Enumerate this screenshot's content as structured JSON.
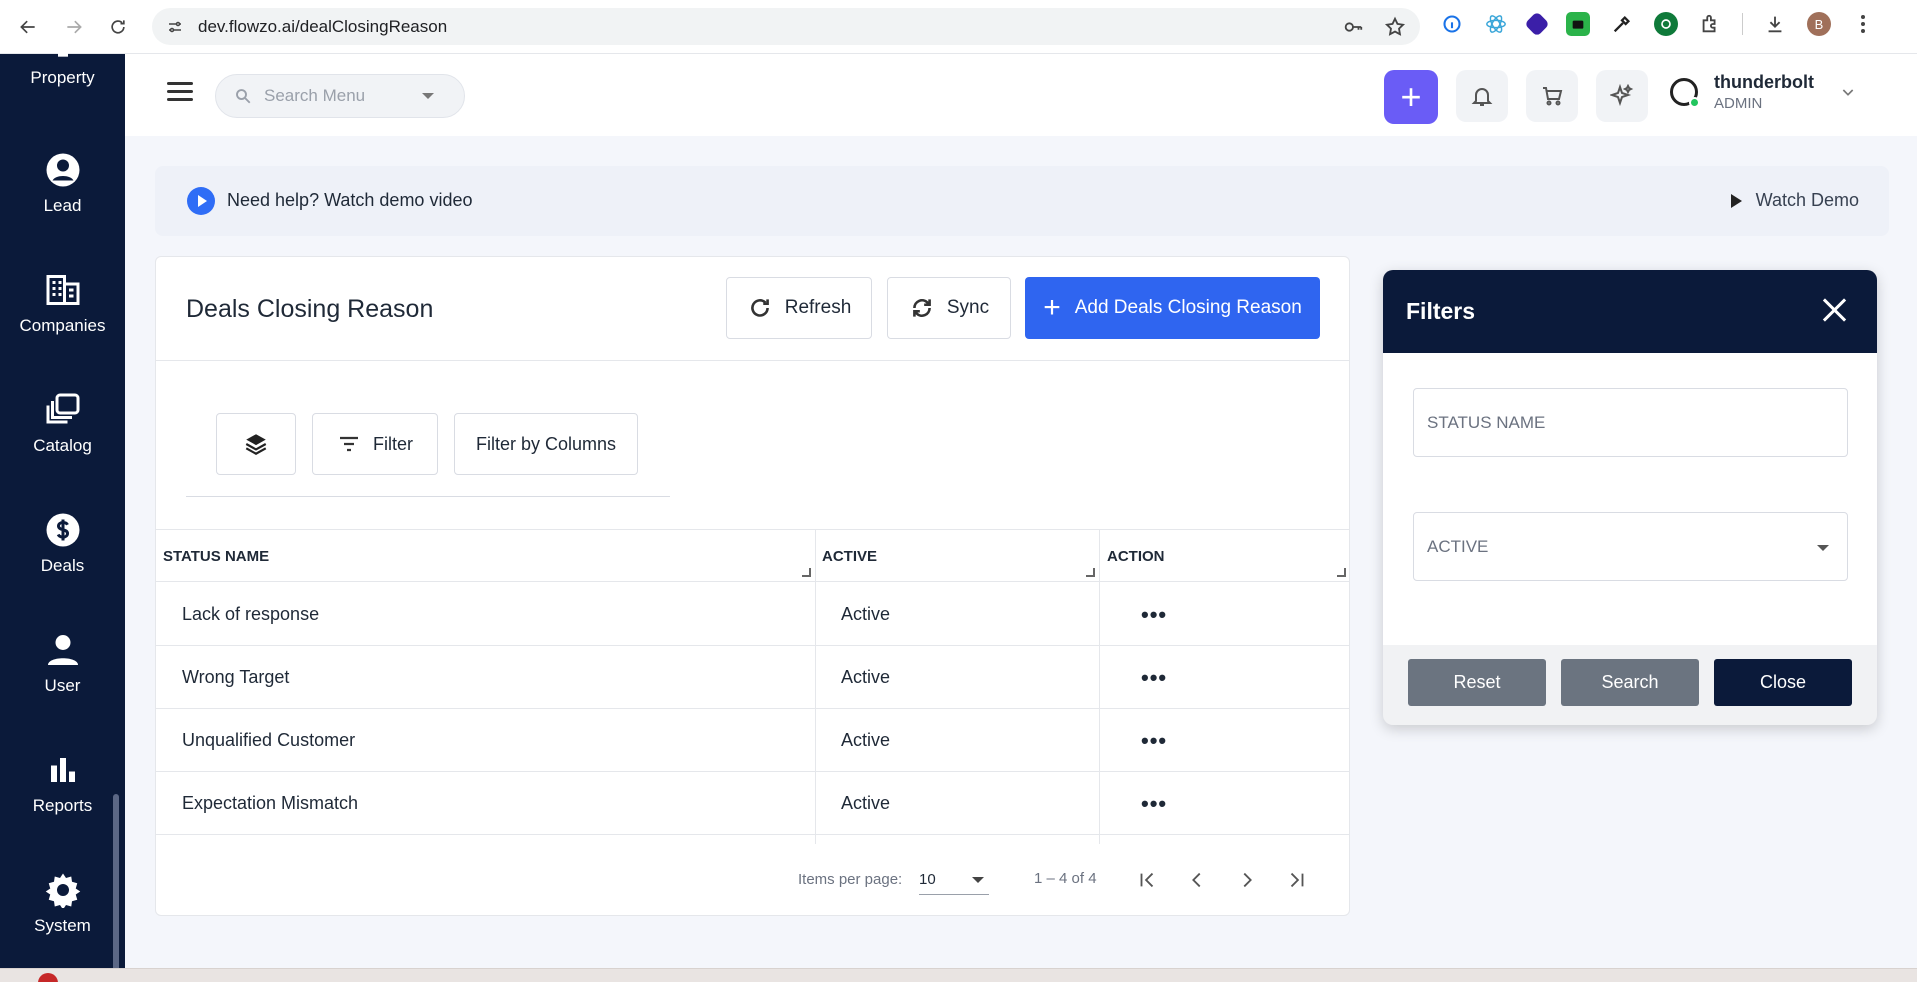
{
  "browser": {
    "url": "dev.flowzo.ai/dealClosingReason",
    "profile_initial": "B"
  },
  "sidebar": {
    "items": [
      {
        "label": "Property",
        "icon": "building-icon"
      },
      {
        "label": "Lead",
        "icon": "account-circle-icon"
      },
      {
        "label": "Companies",
        "icon": "companies-icon"
      },
      {
        "label": "Catalog",
        "icon": "catalog-icon"
      },
      {
        "label": "Deals",
        "icon": "dollar-icon"
      },
      {
        "label": "User",
        "icon": "user-icon"
      },
      {
        "label": "Reports",
        "icon": "bar-chart-icon"
      },
      {
        "label": "System",
        "icon": "gear-icon"
      }
    ]
  },
  "topbar": {
    "search_placeholder": "Search Menu",
    "user_name": "thunderbolt",
    "user_role": "ADMIN"
  },
  "help": {
    "text": "Need help? Watch demo video",
    "watch_label": "Watch Demo"
  },
  "page": {
    "title": "Deals Closing Reason",
    "refresh_label": "Refresh",
    "sync_label": "Sync",
    "add_label": "Add Deals Closing Reason",
    "filter_label": "Filter",
    "filter_columns_label": "Filter by Columns"
  },
  "table": {
    "columns": [
      "STATUS NAME",
      "ACTIVE",
      "ACTION"
    ],
    "rows": [
      {
        "name": "Lack of response",
        "active": "Active"
      },
      {
        "name": "Wrong Target",
        "active": "Active"
      },
      {
        "name": "Unqualified Customer",
        "active": "Active"
      },
      {
        "name": "Expectation Mismatch",
        "active": "Active"
      }
    ],
    "action_glyph": "•••"
  },
  "pagination": {
    "items_per_page_label": "Items per page:",
    "items_per_page_value": "10",
    "range": "1 – 4 of 4"
  },
  "filters": {
    "title": "Filters",
    "status_placeholder": "STATUS NAME",
    "active_placeholder": "ACTIVE",
    "reset_label": "Reset",
    "search_label": "Search",
    "close_label": "Close"
  },
  "colors": {
    "sidebar": "#0b1a3a",
    "primary": "#2f65f0",
    "accent": "#6a5cf6"
  }
}
